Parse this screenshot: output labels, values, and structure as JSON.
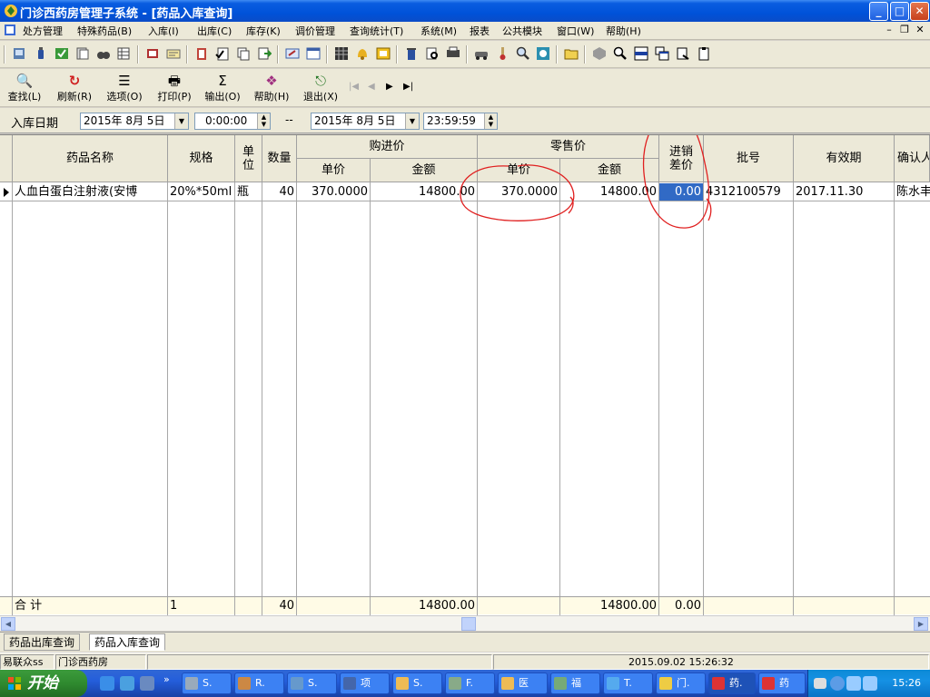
{
  "window": {
    "title": "门诊西药房管理子系统 - [药品入库查询]",
    "min": "_",
    "max": "□",
    "close": "✕"
  },
  "menu": {
    "items": [
      "处方管理",
      "特殊药品(B)",
      "入库(I)",
      "出库(C)",
      "库存(K)",
      "调价管理",
      "查询统计(T)",
      "系统(M)",
      "报表",
      "公共模块",
      "窗口(W)",
      "帮助(H)"
    ],
    "mdi": [
      "–",
      "❐",
      "✕"
    ]
  },
  "toolbar": {
    "buttons": [
      {
        "glyph": "🔍",
        "label": "查找(L)",
        "icon": "find-icon"
      },
      {
        "glyph": "↻",
        "label": "刷新(R)",
        "icon": "refresh-icon"
      },
      {
        "glyph": "☰",
        "label": "选项(O)",
        "icon": "options-icon"
      },
      {
        "glyph": "🖶",
        "label": "打印(P)",
        "icon": "print-icon"
      },
      {
        "glyph": "Σ",
        "label": "输出(O)",
        "icon": "export-icon"
      },
      {
        "glyph": "❖",
        "label": "帮助(H)",
        "icon": "help-icon"
      },
      {
        "glyph": "⎋",
        "label": "退出(X)",
        "icon": "exit-icon"
      }
    ],
    "nav": [
      "|◀",
      "◀",
      "▶",
      "▶|"
    ]
  },
  "filter": {
    "label": "入库日期",
    "start_date": "2015年 8月 5日",
    "start_time": "0:00:00",
    "separator": "--",
    "end_date": "2015年 8月 5日",
    "end_time": "23:59:59"
  },
  "grid": {
    "headers": {
      "name": "药品名称",
      "spec": "规格",
      "unit": "单\n位",
      "qty": "数量",
      "purchase": "购进价",
      "retail": "零售价",
      "unit_price": "单价",
      "amount": "金额",
      "diff": "进销\n差价",
      "batch": "批号",
      "expiry": "有效期",
      "confirm": "确认人"
    },
    "rows": [
      {
        "name": "人血白蛋白注射液(安博",
        "spec": "20%*50ml",
        "unit": "瓶",
        "qty": "40",
        "purchase_price": "370.0000",
        "purchase_amount": "14800.00",
        "retail_price": "370.0000",
        "retail_amount": "14800.00",
        "diff": "0.00",
        "batch": "4312100579",
        "expiry": "2017.11.30",
        "confirm": "陈水丰"
      }
    ],
    "total": {
      "label": "合  计",
      "count": "1",
      "qty": "40",
      "purchase_amount": "14800.00",
      "retail_amount": "14800.00",
      "diff": "0.00"
    }
  },
  "tabs": [
    "药品出库查询",
    "药品入库查询"
  ],
  "status": {
    "user": "易联众ss",
    "dept": "门诊西药房",
    "datetime": "2015.09.02 15:26:32"
  },
  "taskbar": {
    "start": "开始",
    "tasks": [
      "S.",
      "R.",
      "S.",
      "项",
      "S.",
      "F.",
      "医",
      "福",
      "T.",
      "门.",
      "药.",
      "药"
    ],
    "clock": "15:26"
  }
}
